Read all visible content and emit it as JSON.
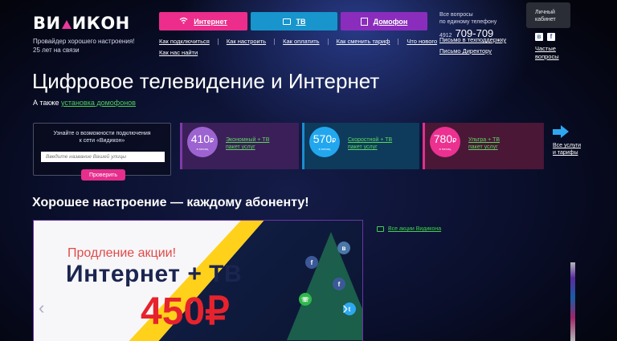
{
  "header": {
    "logo": "ВИДИКОН",
    "tagline_line1": "Провайдер хорошего настроения!",
    "tagline_line2": "25 лет на связи",
    "services": [
      {
        "label": "Интернет",
        "icon": "wifi-icon",
        "color": "#ec2d8b"
      },
      {
        "label": "ТВ",
        "icon": "tv-icon",
        "color": "#1795cc"
      },
      {
        "label": "Домофон",
        "icon": "intercom-icon",
        "color": "#8a2dbc"
      }
    ],
    "menu_row1": [
      "Как подключиться",
      "Как настроить",
      "Как оплатить",
      "Как сменить тариф",
      "Что нового"
    ],
    "menu_row2": [
      "Как нас найти"
    ],
    "contact": {
      "label_line1": "Все вопросы",
      "label_line2": "по единому телефону",
      "phone_code": "4912",
      "phone_number": "709-709",
      "link_support": "Письмо в техподдержку",
      "link_director": "Письмо Директору"
    },
    "cabinet_line1": "Личный",
    "cabinet_line2": "кабинет",
    "social": {
      "vk": "в",
      "fb": "f"
    },
    "faq_line1": "Частые",
    "faq_line2": "вопросы"
  },
  "hero": {
    "title": "Цифровое телевидение и Интернет",
    "also_prefix": "А также",
    "also_link": "установка домофонов"
  },
  "connect": {
    "text_line1": "Узнайте о возможности подключения",
    "text_line2": "к сети «Видикон»",
    "placeholder": "Введите название Вашей улицы",
    "button": "Проверить"
  },
  "tariffs": [
    {
      "price": "410",
      "currency": "₽",
      "period": "в месяц",
      "name_line1": "Экономный + ТВ",
      "name_line2": "пакет услуг"
    },
    {
      "price": "570",
      "currency": "₽",
      "period": "в месяц",
      "name_line1": "Скоростной + ТВ",
      "name_line2": "пакет услуг"
    },
    {
      "price": "780",
      "currency": "₽",
      "period": "в месяц",
      "name_line1": "Ультра + ТВ",
      "name_line2": "пакет услуг"
    }
  ],
  "more_tariffs": {
    "line1": "Все услуги",
    "line2": "и тарифы"
  },
  "slogan": "Хорошее настроение — каждому абоненту!",
  "promo": {
    "kicker": "Продление акции!",
    "product": "Интернет + ТВ",
    "price": "450₽",
    "prev": "‹",
    "next": "›"
  },
  "all_promos": "Все акции Видикона",
  "colors": {
    "internet": "#ec2d8b",
    "tv": "#1795cc",
    "intercom": "#8a2dbc",
    "link_green": "#4ed05a"
  }
}
